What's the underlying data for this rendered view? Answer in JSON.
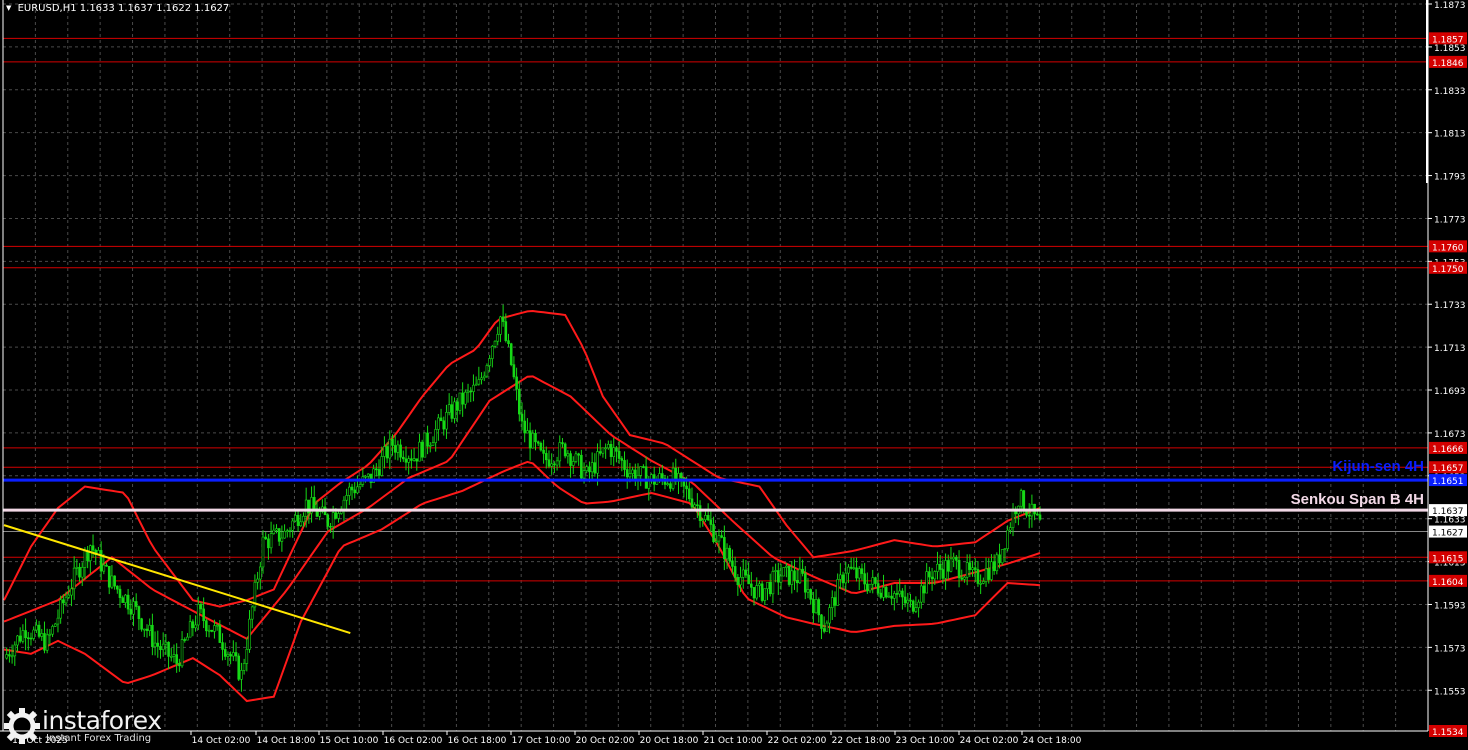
{
  "header": {
    "symbol": "EURUSD,H1",
    "ohlc": "1.1633 1.1637 1.1622 1.1627"
  },
  "logo": {
    "name": "instaforex",
    "tagline": "Instant Forex Trading"
  },
  "colors": {
    "background": "#000000",
    "grid": "#4a4a4a",
    "axis": "#ffffff",
    "level_line": "#d40000",
    "kijun": "#0a1fff",
    "senkou": "#f2d8e6",
    "trend": "#ffe600",
    "candle_up": "#16d916",
    "candle_down": "#16d916",
    "bands": "#ff1a1a"
  },
  "chart_data": {
    "type": "candlestick",
    "symbol": "EURUSD",
    "timeframe": "H1",
    "ylim": [
      1.1534,
      1.1873
    ],
    "grid": true,
    "y_ticks": [
      "1.1873",
      "1.1853",
      "1.1833",
      "1.1813",
      "1.1793",
      "1.1773",
      "1.1753",
      "1.1733",
      "1.1713",
      "1.1693",
      "1.1673",
      "1.1653",
      "1.1633",
      "1.1613",
      "1.1593",
      "1.1573",
      "1.1553"
    ],
    "x_ticks": [
      "14 Oct 02:00",
      "14 Oct 18:00",
      "15 Oct 10:00",
      "16 Oct 02:00",
      "16 Oct 18:00",
      "17 Oct 10:00",
      "20 Oct 02:00",
      "20 Oct 18:00",
      "21 Oct 10:00",
      "22 Oct 02:00",
      "22 Oct 18:00",
      "23 Oct 10:00",
      "24 Oct 02:00",
      "24 Oct 18:00"
    ],
    "first_x_label": "13 Oct 2025",
    "levels": [
      {
        "value": 1.1857,
        "label": "1.1857"
      },
      {
        "value": 1.1846,
        "label": "1.1846"
      },
      {
        "value": 1.176,
        "label": "1.1760"
      },
      {
        "value": 1.175,
        "label": "1.1750"
      },
      {
        "value": 1.1666,
        "label": "1.1666"
      },
      {
        "value": 1.1657,
        "label": "1.1657"
      },
      {
        "value": 1.1615,
        "label": "1.1615"
      },
      {
        "value": 1.1604,
        "label": "1.1604"
      },
      {
        "value": 1.1534,
        "label": "1.1534"
      }
    ],
    "kijun_sen": {
      "name": "Kijun-sen 4H",
      "value": 1.1651,
      "label": "1.1651"
    },
    "senkou_span_b": {
      "name": "Senkou Span B 4H",
      "value": 1.1637,
      "label": "1.1637"
    },
    "current_price": {
      "value": 1.1627,
      "label": "1.1627"
    },
    "trend_line": {
      "start": [
        0,
        1.163
      ],
      "end": [
        95,
        1.1575
      ]
    },
    "price_path": [
      [
        0,
        1.1568
      ],
      [
        8,
        1.1582
      ],
      [
        16,
        1.1575
      ],
      [
        24,
        1.16
      ],
      [
        32,
        1.1621
      ],
      [
        40,
        1.1603
      ],
      [
        48,
        1.1592
      ],
      [
        56,
        1.1575
      ],
      [
        64,
        1.1566
      ],
      [
        72,
        1.1589
      ],
      [
        80,
        1.1578
      ],
      [
        88,
        1.156
      ],
      [
        96,
        1.1622
      ],
      [
        104,
        1.1626
      ],
      [
        112,
        1.164
      ],
      [
        120,
        1.1632
      ],
      [
        128,
        1.1646
      ],
      [
        136,
        1.1652
      ],
      [
        144,
        1.1668
      ],
      [
        152,
        1.1662
      ],
      [
        160,
        1.1674
      ],
      [
        168,
        1.1686
      ],
      [
        176,
        1.1695
      ],
      [
        184,
        1.1727
      ],
      [
        188,
        1.1705
      ],
      [
        192,
        1.1676
      ],
      [
        200,
        1.166
      ],
      [
        208,
        1.1666
      ],
      [
        216,
        1.1653
      ],
      [
        224,
        1.1667
      ],
      [
        232,
        1.1655
      ],
      [
        240,
        1.1651
      ],
      [
        248,
        1.1652
      ],
      [
        256,
        1.1641
      ],
      [
        264,
        1.1625
      ],
      [
        272,
        1.1607
      ],
      [
        280,
        1.1598
      ],
      [
        288,
        1.1607
      ],
      [
        296,
        1.1605
      ],
      [
        304,
        1.1583
      ],
      [
        312,
        1.161
      ],
      [
        320,
        1.1603
      ],
      [
        328,
        1.16
      ],
      [
        336,
        1.1592
      ],
      [
        344,
        1.1608
      ],
      [
        352,
        1.1612
      ],
      [
        360,
        1.1605
      ],
      [
        368,
        1.1612
      ],
      [
        376,
        1.1643
      ],
      [
        384,
        1.163
      ]
    ],
    "bollinger": {
      "upper": [
        [
          0,
          1.1595
        ],
        [
          10,
          1.162
        ],
        [
          20,
          1.1638
        ],
        [
          30,
          1.1648
        ],
        [
          45,
          1.1645
        ],
        [
          55,
          1.162
        ],
        [
          70,
          1.1595
        ],
        [
          80,
          1.1592
        ],
        [
          90,
          1.1595
        ],
        [
          100,
          1.16
        ],
        [
          115,
          1.164
        ],
        [
          125,
          1.165
        ],
        [
          135,
          1.1658
        ],
        [
          145,
          1.1672
        ],
        [
          155,
          1.169
        ],
        [
          165,
          1.1705
        ],
        [
          175,
          1.1712
        ],
        [
          183,
          1.1726
        ],
        [
          195,
          1.173
        ],
        [
          208,
          1.1728
        ],
        [
          215,
          1.1712
        ],
        [
          222,
          1.169
        ],
        [
          232,
          1.1672
        ],
        [
          245,
          1.1668
        ],
        [
          255,
          1.166
        ],
        [
          265,
          1.1652
        ],
        [
          280,
          1.1648
        ],
        [
          290,
          1.163
        ],
        [
          300,
          1.1615
        ],
        [
          315,
          1.1618
        ],
        [
          330,
          1.1623
        ],
        [
          345,
          1.162
        ],
        [
          360,
          1.1622
        ],
        [
          372,
          1.1632
        ],
        [
          384,
          1.1638
        ]
      ],
      "middle": [
        [
          0,
          1.1585
        ],
        [
          20,
          1.1595
        ],
        [
          40,
          1.1615
        ],
        [
          55,
          1.16
        ],
        [
          70,
          1.159
        ],
        [
          90,
          1.1577
        ],
        [
          105,
          1.16
        ],
        [
          120,
          1.1627
        ],
        [
          135,
          1.1638
        ],
        [
          150,
          1.1652
        ],
        [
          165,
          1.166
        ],
        [
          180,
          1.1688
        ],
        [
          195,
          1.17
        ],
        [
          210,
          1.169
        ],
        [
          225,
          1.1672
        ],
        [
          240,
          1.166
        ],
        [
          255,
          1.165
        ],
        [
          270,
          1.1632
        ],
        [
          285,
          1.1615
        ],
        [
          300,
          1.1606
        ],
        [
          315,
          1.1598
        ],
        [
          330,
          1.1603
        ],
        [
          345,
          1.1603
        ],
        [
          360,
          1.1608
        ],
        [
          372,
          1.1612
        ],
        [
          384,
          1.1617
        ]
      ],
      "lower": [
        [
          0,
          1.1572
        ],
        [
          10,
          1.157
        ],
        [
          20,
          1.1576
        ],
        [
          30,
          1.157
        ],
        [
          45,
          1.1556
        ],
        [
          55,
          1.156
        ],
        [
          70,
          1.1568
        ],
        [
          80,
          1.156
        ],
        [
          90,
          1.1548
        ],
        [
          100,
          1.155
        ],
        [
          110,
          1.1585
        ],
        [
          125,
          1.162
        ],
        [
          140,
          1.1628
        ],
        [
          155,
          1.164
        ],
        [
          170,
          1.1646
        ],
        [
          185,
          1.1655
        ],
        [
          195,
          1.166
        ],
        [
          205,
          1.1648
        ],
        [
          215,
          1.164
        ],
        [
          225,
          1.1641
        ],
        [
          240,
          1.1645
        ],
        [
          255,
          1.164
        ],
        [
          265,
          1.162
        ],
        [
          275,
          1.1596
        ],
        [
          290,
          1.1587
        ],
        [
          300,
          1.1584
        ],
        [
          315,
          1.158
        ],
        [
          330,
          1.1583
        ],
        [
          345,
          1.1584
        ],
        [
          360,
          1.1588
        ],
        [
          372,
          1.1603
        ],
        [
          384,
          1.1602
        ]
      ]
    }
  }
}
